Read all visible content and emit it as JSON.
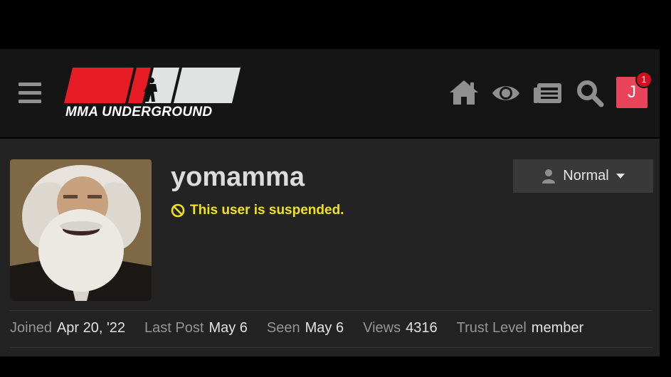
{
  "header": {
    "logo_text": "MMA UNDERGROUND",
    "menu_icon": "hamburger-menu-icon",
    "icons": [
      "home-icon",
      "eye-icon",
      "news-icon",
      "search-icon"
    ],
    "user_initial": "J",
    "notification_count": "1",
    "colors": {
      "logo_red": "#e81c24",
      "logo_gray": "#dfe3e1",
      "avatar_bg": "#e8455a",
      "badge": "#d0101e"
    }
  },
  "profile": {
    "username": "yomamma",
    "suspended_text": "This user is suspended.",
    "suspended_color": "#f2e21a",
    "notification_level": "Normal",
    "stats": [
      {
        "label": "Joined",
        "value": "Apr 20, '22"
      },
      {
        "label": "Last Post",
        "value": "May 6"
      },
      {
        "label": "Seen",
        "value": "May 6"
      },
      {
        "label": "Views",
        "value": "4316"
      },
      {
        "label": "Trust Level",
        "value": "member"
      }
    ]
  }
}
